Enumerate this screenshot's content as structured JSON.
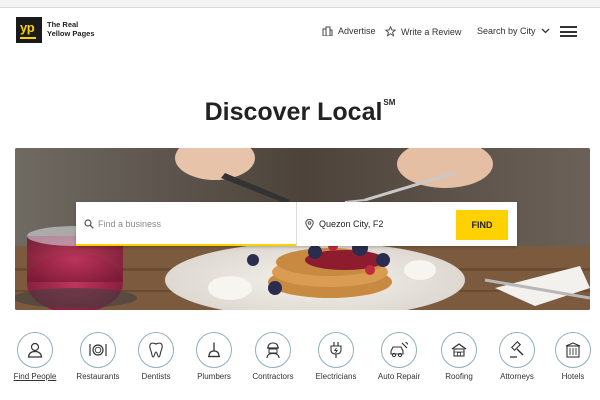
{
  "brand": {
    "line1": "The Real",
    "line2": "Yellow Pages",
    "logo_text": "yp"
  },
  "nav": {
    "advertise": "Advertise",
    "write_review": "Write a Review",
    "search_by_city": "Search by City"
  },
  "hero": {
    "title": "Discover Local",
    "mark": "SM"
  },
  "search": {
    "what_placeholder": "Find a business",
    "where_value": "Quezon City, F2",
    "find_label": "FIND"
  },
  "categories": [
    {
      "label": "Find People",
      "icon": "person-icon"
    },
    {
      "label": "Restaurants",
      "icon": "plate-utensils-icon"
    },
    {
      "label": "Dentists",
      "icon": "tooth-icon"
    },
    {
      "label": "Plumbers",
      "icon": "plunger-icon"
    },
    {
      "label": "Contractors",
      "icon": "worker-icon"
    },
    {
      "label": "Electricians",
      "icon": "plug-icon"
    },
    {
      "label": "Auto Repair",
      "icon": "car-wrench-icon"
    },
    {
      "label": "Roofing",
      "icon": "house-roof-icon"
    },
    {
      "label": "Attorneys",
      "icon": "gavel-icon"
    },
    {
      "label": "Hotels",
      "icon": "hotel-icon"
    }
  ],
  "colors": {
    "brand_yellow": "#ffd100",
    "icon_ring": "#8fb0bf",
    "text": "#222222"
  }
}
